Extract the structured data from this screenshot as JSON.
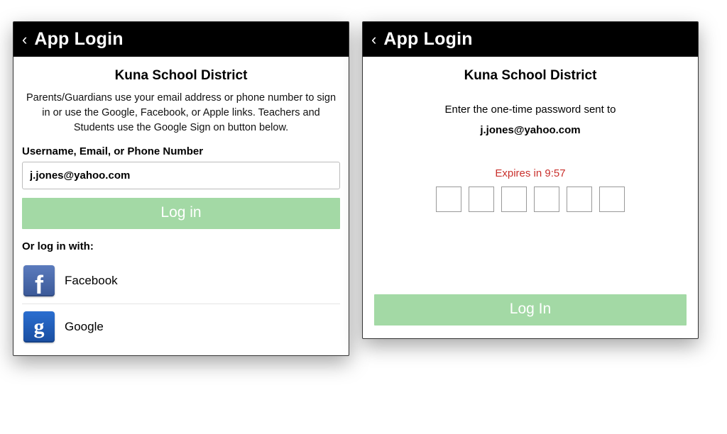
{
  "left": {
    "header": {
      "title": "App Login"
    },
    "district": "Kuna School District",
    "instructions": "Parents/Guardians use your email address or phone number to sign in or use the Google, Facebook, or Apple links.  Teachers and Students use the Google Sign on button below.",
    "field_label": "Username, Email, or Phone Number",
    "username_value": "j.jones@yahoo.com",
    "login_label": "Log in",
    "or_label": "Or log in with:",
    "social": {
      "facebook_label": "Facebook",
      "google_label": "Google"
    }
  },
  "right": {
    "header": {
      "title": "App Login"
    },
    "district": "Kuna School District",
    "otp_text": "Enter the one-time password sent to",
    "otp_email": "j.jones@yahoo.com",
    "expires_label": "Expires in 9:57",
    "login_label": "Log In"
  }
}
